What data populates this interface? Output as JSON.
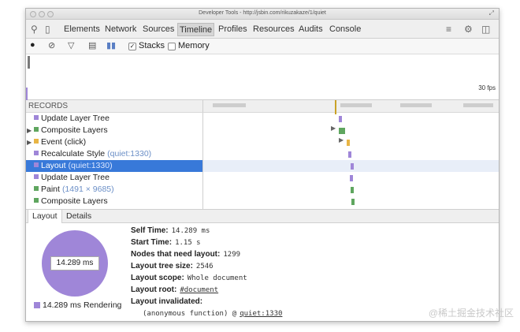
{
  "window": {
    "title": "Developer Tools - http://jsbin.com/rikuzakaze/1/quiet"
  },
  "tabs": [
    "Elements",
    "Network",
    "Sources",
    "Timeline",
    "Profiles",
    "Resources",
    "Audits",
    "Console"
  ],
  "selected_tab": "Timeline",
  "toolbar": {
    "stacks_label": "Stacks",
    "stacks_checked": true,
    "memory_label": "Memory",
    "memory_checked": false
  },
  "overview": {
    "fps_label": "30 fps"
  },
  "records": {
    "header": "RECORDS",
    "items": [
      {
        "label": "Update Layer Tree",
        "link": "",
        "color": "#9f86d8",
        "expandable": false,
        "selected": false
      },
      {
        "label": "Composite Layers",
        "link": "",
        "color": "#5fa65f",
        "expandable": true,
        "selected": false
      },
      {
        "label": "Event (click)",
        "link": "",
        "color": "#e8b545",
        "expandable": true,
        "selected": false
      },
      {
        "label": "Recalculate Style",
        "link": "(quiet:1330)",
        "color": "#9f86d8",
        "expandable": false,
        "selected": false
      },
      {
        "label": "Layout",
        "link": "(quiet:1330)",
        "color": "#9f86d8",
        "expandable": false,
        "selected": true
      },
      {
        "label": "Update Layer Tree",
        "link": "",
        "color": "#9f86d8",
        "expandable": false,
        "selected": false
      },
      {
        "label": "Paint",
        "link": "(1491 × 9685)",
        "color": "#5fa65f",
        "expandable": false,
        "selected": false
      },
      {
        "label": "Composite Layers",
        "link": "",
        "color": "#5fa65f",
        "expandable": false,
        "selected": false
      }
    ]
  },
  "bottom_tabs": [
    "Layout",
    "Details"
  ],
  "selected_bottom_tab": "Layout",
  "details": {
    "pie_label": "14.289 ms",
    "legend": "14.289 ms Rendering",
    "legend_color": "#9f86d8",
    "rows": [
      {
        "label": "Self Time:",
        "value": "14.289 ms",
        "underline": false
      },
      {
        "label": "Start Time:",
        "value": "1.15 s",
        "underline": false
      },
      {
        "label": "Nodes that need layout:",
        "value": "1299",
        "underline": false
      },
      {
        "label": "Layout tree size:",
        "value": "2546",
        "underline": false
      },
      {
        "label": "Layout scope:",
        "value": "Whole document",
        "underline": false
      },
      {
        "label": "Layout root:",
        "value": "#document",
        "underline": true
      },
      {
        "label": "Layout invalidated:",
        "value": "",
        "underline": false
      }
    ],
    "invalidated_prefix": "(anonymous function) @",
    "invalidated_link": "quiet:1330"
  },
  "watermark": "@稀土掘金技术社区",
  "colors": {
    "rendering": "#9f86d8",
    "painting": "#5fa65f",
    "scripting": "#e8b545",
    "selection": "#3879d9"
  }
}
